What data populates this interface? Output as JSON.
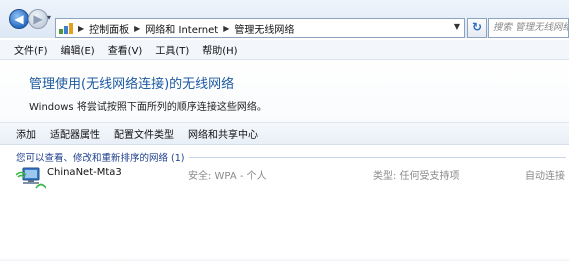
{
  "nav": {
    "back_glyph": "◀",
    "forward_glyph": "▶",
    "recent_glyph": "▾",
    "breadcrumbs": [
      "控制面板",
      "网络和 Internet",
      "管理无线网络"
    ],
    "refresh_glyph": "↻",
    "search_placeholder": "搜索 管理无线网络"
  },
  "menu": {
    "items": [
      "文件(F)",
      "编辑(E)",
      "查看(V)",
      "工具(T)",
      "帮助(H)"
    ]
  },
  "header": {
    "title": "管理使用(无线网络连接)的无线网络",
    "description": "Windows 将尝试按照下面所列的顺序连接这些网络。"
  },
  "commands": [
    "添加",
    "适配器属性",
    "配置文件类型",
    "网络和共享中心"
  ],
  "list": {
    "group_label": "您可以查看、修改和重新排序的网络 (1)",
    "networks": [
      {
        "name": "ChinaNet-Mta3",
        "security": "安全: WPA - 个人",
        "type": "类型: 任何受支持项",
        "connect": "自动连接"
      }
    ]
  },
  "colors": {
    "title": "#1e5aa0",
    "group_label": "#1e3f8f",
    "muted_text": "#8a8a8a"
  }
}
